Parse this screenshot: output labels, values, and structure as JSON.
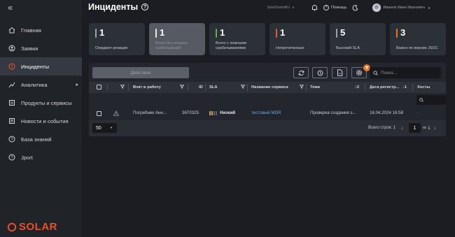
{
  "sidebar": {
    "collapse_glyph": "«",
    "items": [
      {
        "label": "Главная",
        "icon": "home-icon",
        "active": false
      },
      {
        "label": "Заявки",
        "icon": "requests-icon",
        "active": false
      },
      {
        "label": "Инциденты",
        "icon": "incidents-icon",
        "active": true
      },
      {
        "label": "Аналитика",
        "icon": "analytics-icon",
        "active": false,
        "arrow": "▸"
      },
      {
        "label": "Продукты и сервисы",
        "icon": "products-icon",
        "active": false
      },
      {
        "label": "Новости и события",
        "icon": "news-icon",
        "active": false
      },
      {
        "label": "База знаний",
        "icon": "knowledge-icon",
        "active": false
      },
      {
        "label": "Jport",
        "icon": "jport-icon",
        "active": false
      }
    ],
    "logo_text": "SOLAR"
  },
  "header": {
    "title": "Инциденты",
    "title_help_glyph": "?",
    "org": "SolarDemoRU",
    "help_glyph": "?",
    "help_label": "Помощь",
    "user_name": "Иванов Иван Иванович"
  },
  "cards": [
    {
      "value": "1",
      "label": "Ожидают реакции",
      "bar_color": "#9ea3ab",
      "selected": false
    },
    {
      "value": "1",
      "label": "Всего без ложных срабатываний",
      "bar_color": "#e8e9ec",
      "selected": true
    },
    {
      "value": "1",
      "label": "Всего с ложными срабатываниями",
      "bar_color": "#5fb04d",
      "selected": false
    },
    {
      "value": "1",
      "label": "Непрочитанные",
      "bar_color": "#e0574a",
      "selected": false
    },
    {
      "value": "5",
      "label": "Высокий SLA",
      "bar_color": "#9ea3ab",
      "selected": false
    },
    {
      "value": "3",
      "label": "Важно по версии JSOC",
      "bar_color": "#e8762b",
      "selected": false
    }
  ],
  "toolbar": {
    "actions_label": "Действия",
    "search_placeholder": "Поиск..."
  },
  "table": {
    "columns": {
      "taken": "Взят в работу",
      "id": "ID",
      "sla": "SLA",
      "service": "Название сервиса",
      "topic": "Тема",
      "topic_sort": "↕2",
      "registered": "Дата регистр...",
      "registered_sort": "↓1",
      "hosts": "Хосты"
    },
    "rows": [
      {
        "taken": "Погребник Анн...",
        "id": "3670325",
        "sla": "Низкий",
        "service": "тестовый MDR",
        "topic": "Проверка создания з...",
        "registered": "16.04.2024 16:58",
        "hosts": "-"
      }
    ]
  },
  "footer": {
    "per_page": "50",
    "total_label": "Всего строк: 1",
    "page": "1",
    "of_label": "из",
    "pages": "1"
  },
  "colors": {
    "accent": "#e8502b",
    "link": "#6ea8e8",
    "sla_low": "#c2a35a"
  }
}
